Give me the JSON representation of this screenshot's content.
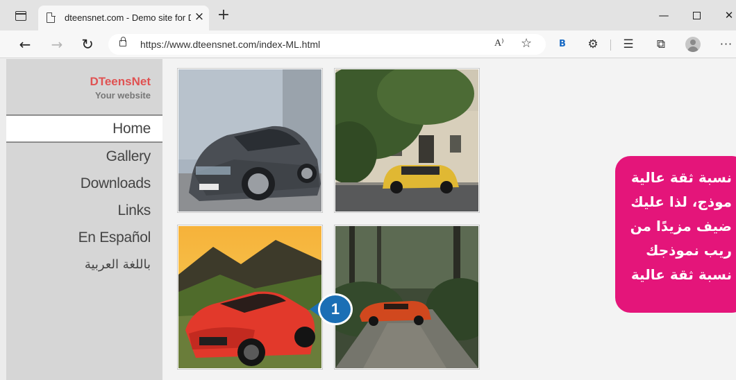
{
  "browser": {
    "tab_title": "dteensnet.com - Demo site for D",
    "tab_close": "×",
    "new_tab": "+",
    "url": "https://www.dteensnet.com/index-ML.html",
    "read_aloud_label": "A⁾",
    "bing_label": "B",
    "window_min": "—",
    "window_close": "✕",
    "more_label": "···",
    "icons": {
      "back": "arrow-left-icon",
      "forward": "arrow-right-icon",
      "refresh": "refresh-icon",
      "lock": "lock-icon",
      "favorite_add": "star-add-icon",
      "extensions": "puzzle-icon",
      "favorites": "favorites-icon",
      "collections": "collections-icon",
      "profile": "profile-icon"
    }
  },
  "site": {
    "brand_name": "DTeensNet",
    "brand_tagline": "Your website",
    "brand_color": "#e05252",
    "nav": [
      {
        "label": "Home",
        "active": true
      },
      {
        "label": "Gallery",
        "active": false
      },
      {
        "label": "Downloads",
        "active": false
      },
      {
        "label": "Links",
        "active": false
      },
      {
        "label": "En Español",
        "active": false
      },
      {
        "label": "باللغة العربية",
        "active": false
      }
    ],
    "gallery": [
      {
        "subject": "grey hatchback car"
      },
      {
        "subject": "yellow mini car on street"
      },
      {
        "subject": "red convertible car"
      },
      {
        "subject": "orange vintage car on forest road"
      }
    ]
  },
  "overlay": {
    "callout_number": "1",
    "callout_color": "#1b6fb5",
    "note_color": "#e4157a",
    "note_lines": [
      "نسبة ثقة عالية",
      "موذج، لذا عليك",
      "ضيف مزيدًا من",
      "ريب نموذجك",
      "نسبة ثقة عالية"
    ]
  }
}
